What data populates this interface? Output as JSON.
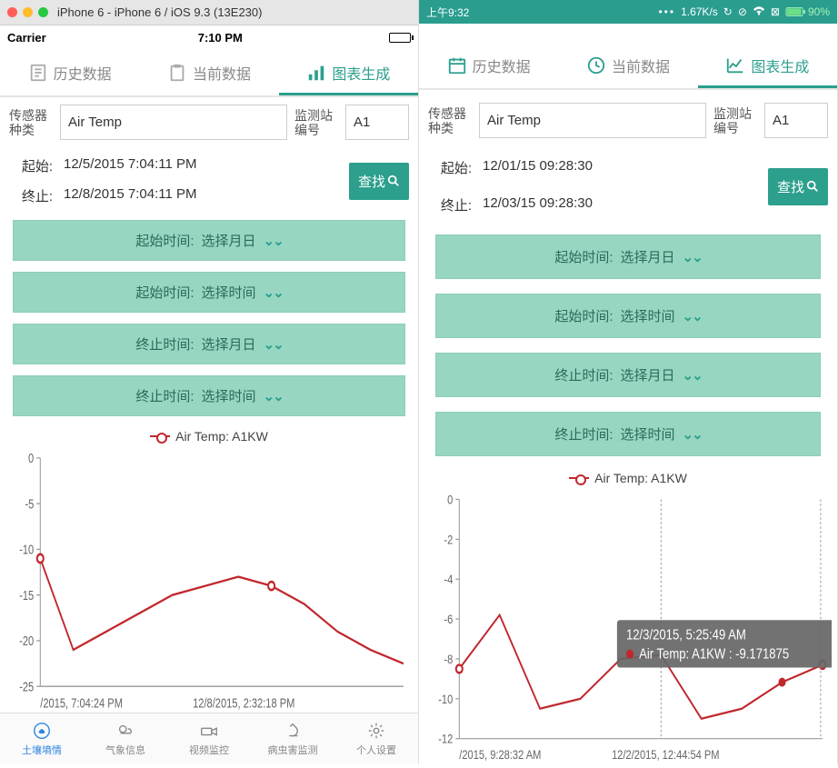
{
  "left": {
    "simTitle": "iPhone 6 - iPhone 6 / iOS 9.3 (13E230)",
    "status": {
      "carrier": "Carrier",
      "time": "7:10 PM"
    },
    "tabs": {
      "history": "历史数据",
      "current": "当前数据",
      "chart": "图表生成"
    },
    "form": {
      "sensorLabel": "传感器\n种类",
      "sensorValue": "Air Temp",
      "stationLabel": "监测站\n编号",
      "stationValue": "A1",
      "startLabel": "起始:",
      "startValue": "12/5/2015 7:04:11 PM",
      "endLabel": "终止:",
      "endValue": "12/8/2015 7:04:11 PM",
      "searchLabel": "查找"
    },
    "pickers": {
      "p1a": "起始时间:",
      "p1b": "选择月日",
      "p2a": "起始时间:",
      "p2b": "选择时间",
      "p3a": "终止时间:",
      "p3b": "选择月日",
      "p4a": "终止时间:",
      "p4b": "选择时间"
    },
    "legend": "Air Temp: A1KW",
    "xTicks": {
      "a": "/2015, 7:04:24 PM",
      "b": "12/8/2015, 2:32:18 PM"
    },
    "tabbar": {
      "a": "土壤墒情",
      "b": "气象信息",
      "c": "视频监控",
      "d": "病虫害监测",
      "e": "个人设置"
    }
  },
  "right": {
    "status": {
      "time": "上午9:32",
      "net": "1.67K/s",
      "batt": "90%"
    },
    "tabs": {
      "history": "历史数据",
      "current": "当前数据",
      "chart": "图表生成"
    },
    "form": {
      "sensorLabel": "传感器\n种类",
      "sensorValue": "Air Temp",
      "stationLabel": "监测站\n编号",
      "stationValue": "A1",
      "startLabel": "起始:",
      "startValue": "12/01/15 09:28:30",
      "endLabel": "终止:",
      "endValue": "12/03/15 09:28:30",
      "searchLabel": "查找"
    },
    "pickers": {
      "p1a": "起始时间:",
      "p1b": "选择月日",
      "p2a": "起始时间:",
      "p2b": "选择时间",
      "p3a": "终止时间:",
      "p3b": "选择月日",
      "p4a": "终止时间:",
      "p4b": "选择时间"
    },
    "legend": "Air Temp: A1KW",
    "tooltip": {
      "line1": "12/3/2015, 5:25:49 AM",
      "line2": "Air Temp: A1KW : -9.171875"
    },
    "xTicks": {
      "a": "/2015, 9:28:32 AM",
      "b": "12/2/2015, 12:44:54 PM"
    }
  },
  "chart_data": [
    {
      "type": "line",
      "title": "Air Temp: A1KW",
      "ylabel": "",
      "xlabel": "",
      "ylim": [
        -25,
        0
      ],
      "x": [
        "12/5/2015 7:04 PM",
        "12/6/2015 12:00 AM",
        "12/6/2015 6:00 AM",
        "12/6/2015 12:00 PM",
        "12/6/2015 6:00 PM",
        "12/7/2015 12:00 AM",
        "12/7/2015 6:00 AM",
        "12/7/2015 12:00 PM",
        "12/7/2015 6:00 PM",
        "12/8/2015 12:00 AM",
        "12/8/2015 6:00 AM",
        "12/8/2015 2:32 PM"
      ],
      "series": [
        {
          "name": "Air Temp: A1KW",
          "values": [
            -11,
            -21,
            -19,
            -17,
            -15,
            -14,
            -13,
            -14,
            -16,
            -19,
            -21,
            -22.5
          ]
        }
      ]
    },
    {
      "type": "line",
      "title": "Air Temp: A1KW",
      "ylabel": "",
      "xlabel": "",
      "ylim": [
        -12,
        0
      ],
      "x": [
        "12/1/2015 9:28 AM",
        "12/1/2015 3:00 PM",
        "12/1/2015 9:00 PM",
        "12/2/2015 3:00 AM",
        "12/2/2015 9:00 AM",
        "12/2/2015 12:45 PM",
        "12/2/2015 6:00 PM",
        "12/3/2015 12:00 AM",
        "12/3/2015 5:25 AM",
        "12/3/2015 9:28 AM"
      ],
      "series": [
        {
          "name": "Air Temp: A1KW",
          "values": [
            -8.5,
            -5.8,
            -10.5,
            -10,
            -8,
            -7.8,
            -11,
            -10.5,
            -9.17,
            -8.3
          ]
        }
      ],
      "annotations": [
        {
          "x": "12/3/2015 5:25:49 AM",
          "y": -9.171875,
          "text": "Air Temp: A1KW : -9.171875"
        }
      ]
    }
  ]
}
